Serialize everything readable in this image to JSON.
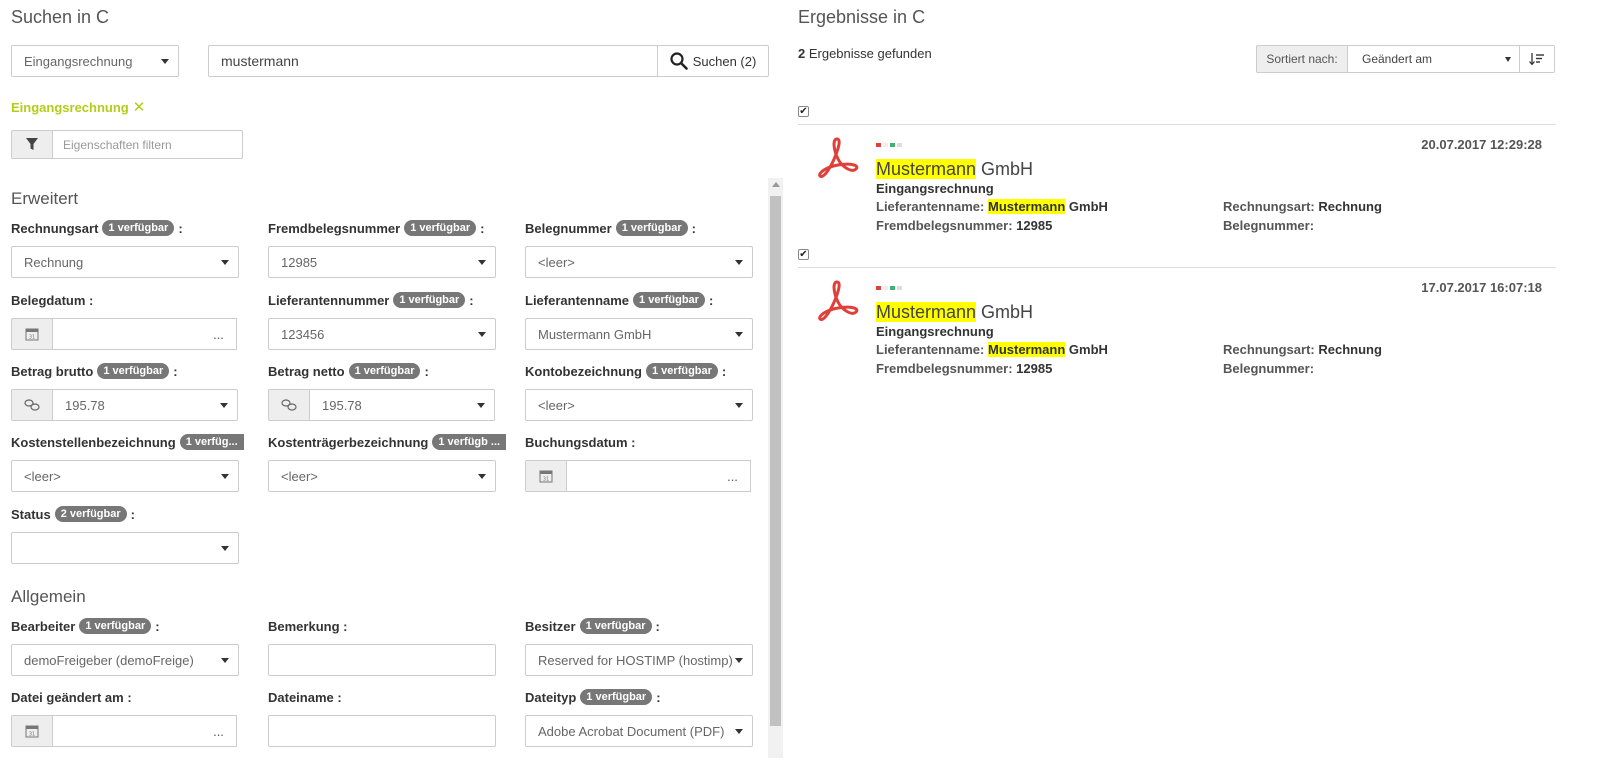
{
  "left": {
    "title": "Suchen in C",
    "category_select": "Eingangsrechnung",
    "search_value": "mustermann",
    "search_button": "Suchen (2)",
    "active_filter": "Eingangsrechnung",
    "filter_placeholder": "Eigenschaften filtern",
    "section_extended": "Erweitert",
    "section_general": "Allgemein",
    "fields": {
      "rechnungsart": {
        "label": "Rechnungsart",
        "badge": "1 verfügbar",
        "value": "Rechnung"
      },
      "fremdbelegsnummer": {
        "label": "Fremdbelegsnummer",
        "badge": "1 verfügbar",
        "value": "12985"
      },
      "belegnummer": {
        "label": "Belegnummer",
        "badge": "1 verfügbar",
        "value": "<leer>"
      },
      "belegdatum": {
        "label": "Belegdatum :",
        "dots": "..."
      },
      "lieferantennummer": {
        "label": "Lieferantennummer",
        "badge": "1 verfügbar",
        "value": "123456"
      },
      "lieferantenname": {
        "label": "Lieferantenname",
        "badge": "1 verfügbar",
        "value": "Mustermann GmbH"
      },
      "betrag_brutto": {
        "label": "Betrag brutto",
        "badge": "1 verfügbar",
        "value": "195.78"
      },
      "betrag_netto": {
        "label": "Betrag netto",
        "badge": "1 verfügbar",
        "value": "195.78"
      },
      "kontobezeichnung": {
        "label": "Kontobezeichnung",
        "badge": "1 verfügbar",
        "value": "<leer>"
      },
      "kostenstellen": {
        "label": "Kostenstellenbezeichnung",
        "badge": "1 verfüg...",
        "value": "<leer>"
      },
      "kostentraeger": {
        "label": "Kostenträgerbezeichnung",
        "badge": "1 verfügb ...",
        "value": "<leer>"
      },
      "buchungsdatum": {
        "label": "Buchungsdatum :",
        "dots": "..."
      },
      "status": {
        "label": "Status",
        "badge": "2 verfügbar",
        "value": ""
      },
      "bearbeiter": {
        "label": "Bearbeiter",
        "badge": "1 verfügbar",
        "value": "demoFreigeber (demoFreige)"
      },
      "bemerkung": {
        "label": "Bemerkung :"
      },
      "besitzer": {
        "label": "Besitzer",
        "badge": "1 verfügbar",
        "value": "Reserved for HOSTIMP (hostimp)"
      },
      "datei_geaendert": {
        "label": "Datei geändert am :",
        "dots": "..."
      },
      "dateiname": {
        "label": "Dateiname :"
      },
      "dateityp": {
        "label": "Dateityp",
        "badge": "1 verfügbar",
        "value": "Adobe Acrobat Document (PDF)"
      }
    },
    "colon": ":"
  },
  "right": {
    "title": "Ergebnisse in C",
    "count_num": "2",
    "count_text": " Ergebnisse gefunden",
    "sort_label": "Sortiert nach:",
    "sort_value": "Geändert am",
    "results": [
      {
        "date": "20.07.2017 12:29:28",
        "title_hl": "Mustermann",
        "title_rest": " GmbH",
        "type": "Eingangsrechnung",
        "lief_label": "Lieferantenname:",
        "lief_hl": "Mustermann",
        "lief_rest": " GmbH",
        "fremd_label": "Fremdbelegsnummer:",
        "fremd_value": "12985",
        "rart_label": "Rechnungsart:",
        "rart_value": "Rechnung",
        "beleg_label": "Belegnummer:"
      },
      {
        "date": "17.07.2017 16:07:18",
        "title_hl": "Mustermann",
        "title_rest": " GmbH",
        "type": "Eingangsrechnung",
        "lief_label": "Lieferantenname:",
        "lief_hl": "Mustermann",
        "lief_rest": " GmbH",
        "fremd_label": "Fremdbelegsnummer:",
        "fremd_value": "12985",
        "rart_label": "Rechnungsart:",
        "rart_value": "Rechnung",
        "beleg_label": "Belegnummer:"
      }
    ]
  },
  "colors": {
    "accent": "#b5cc18",
    "highlight": "#ffff00",
    "badge": "#777777",
    "pdf_red": "#e0403a"
  },
  "icons": [
    "search-icon",
    "close-icon",
    "filter-icon",
    "calendar-icon",
    "coins-icon",
    "sort-icon",
    "pdf-icon",
    "checkbox-icon"
  ]
}
